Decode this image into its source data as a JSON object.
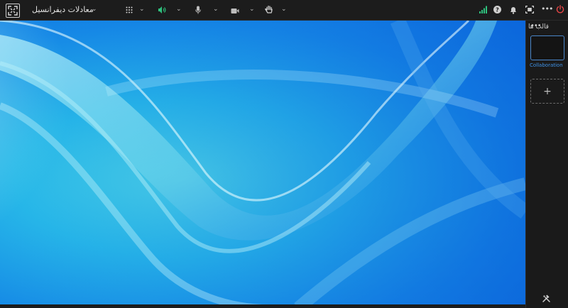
{
  "header": {
    "room_title": "معادلات دیفرانسیل",
    "icons": {
      "expand": "fullscreen-expand-icon",
      "apps": "apps-grid-icon",
      "speaker": "speaker-icon",
      "mic": "microphone-icon",
      "camera": "camera-icon",
      "hand": "raise-hand-icon",
      "signal": "signal-icon",
      "help": "help-icon",
      "bell": "bell-icon",
      "screen": "screen-fit-icon",
      "more": "more-icon",
      "power": "power-icon"
    }
  },
  "sidebar": {
    "title": "قالب ها",
    "tile_label": "Collaboration",
    "add_symbol": "+",
    "tools_icon": "tools-icon"
  },
  "colors": {
    "speaker_green": "#2ec27e",
    "signal_green": "#2ec27e",
    "power_red": "#e64545",
    "tile_blue": "#3f93e8"
  }
}
